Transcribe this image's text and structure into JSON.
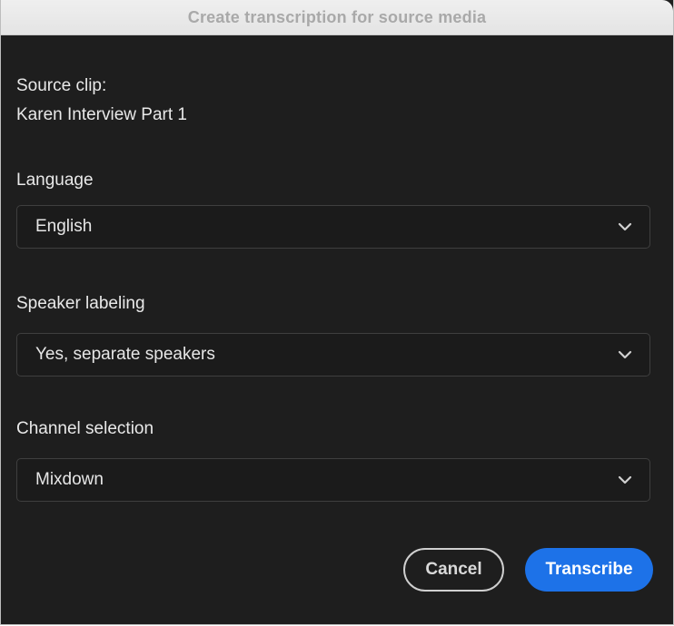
{
  "dialog": {
    "title": "Create transcription for source media"
  },
  "source": {
    "label": "Source clip:",
    "value": "Karen Interview Part 1"
  },
  "language": {
    "label": "Language",
    "selected": "English"
  },
  "speaker_labeling": {
    "label": "Speaker labeling",
    "selected": "Yes, separate speakers"
  },
  "channel_selection": {
    "label": "Channel selection",
    "selected": "Mixdown"
  },
  "buttons": {
    "cancel_label": "Cancel",
    "transcribe_label": "Transcribe"
  },
  "icons": {
    "dropdown": "chevron-down-icon"
  },
  "colors": {
    "primary": "#1d72e8",
    "background": "#1e1e1e"
  }
}
